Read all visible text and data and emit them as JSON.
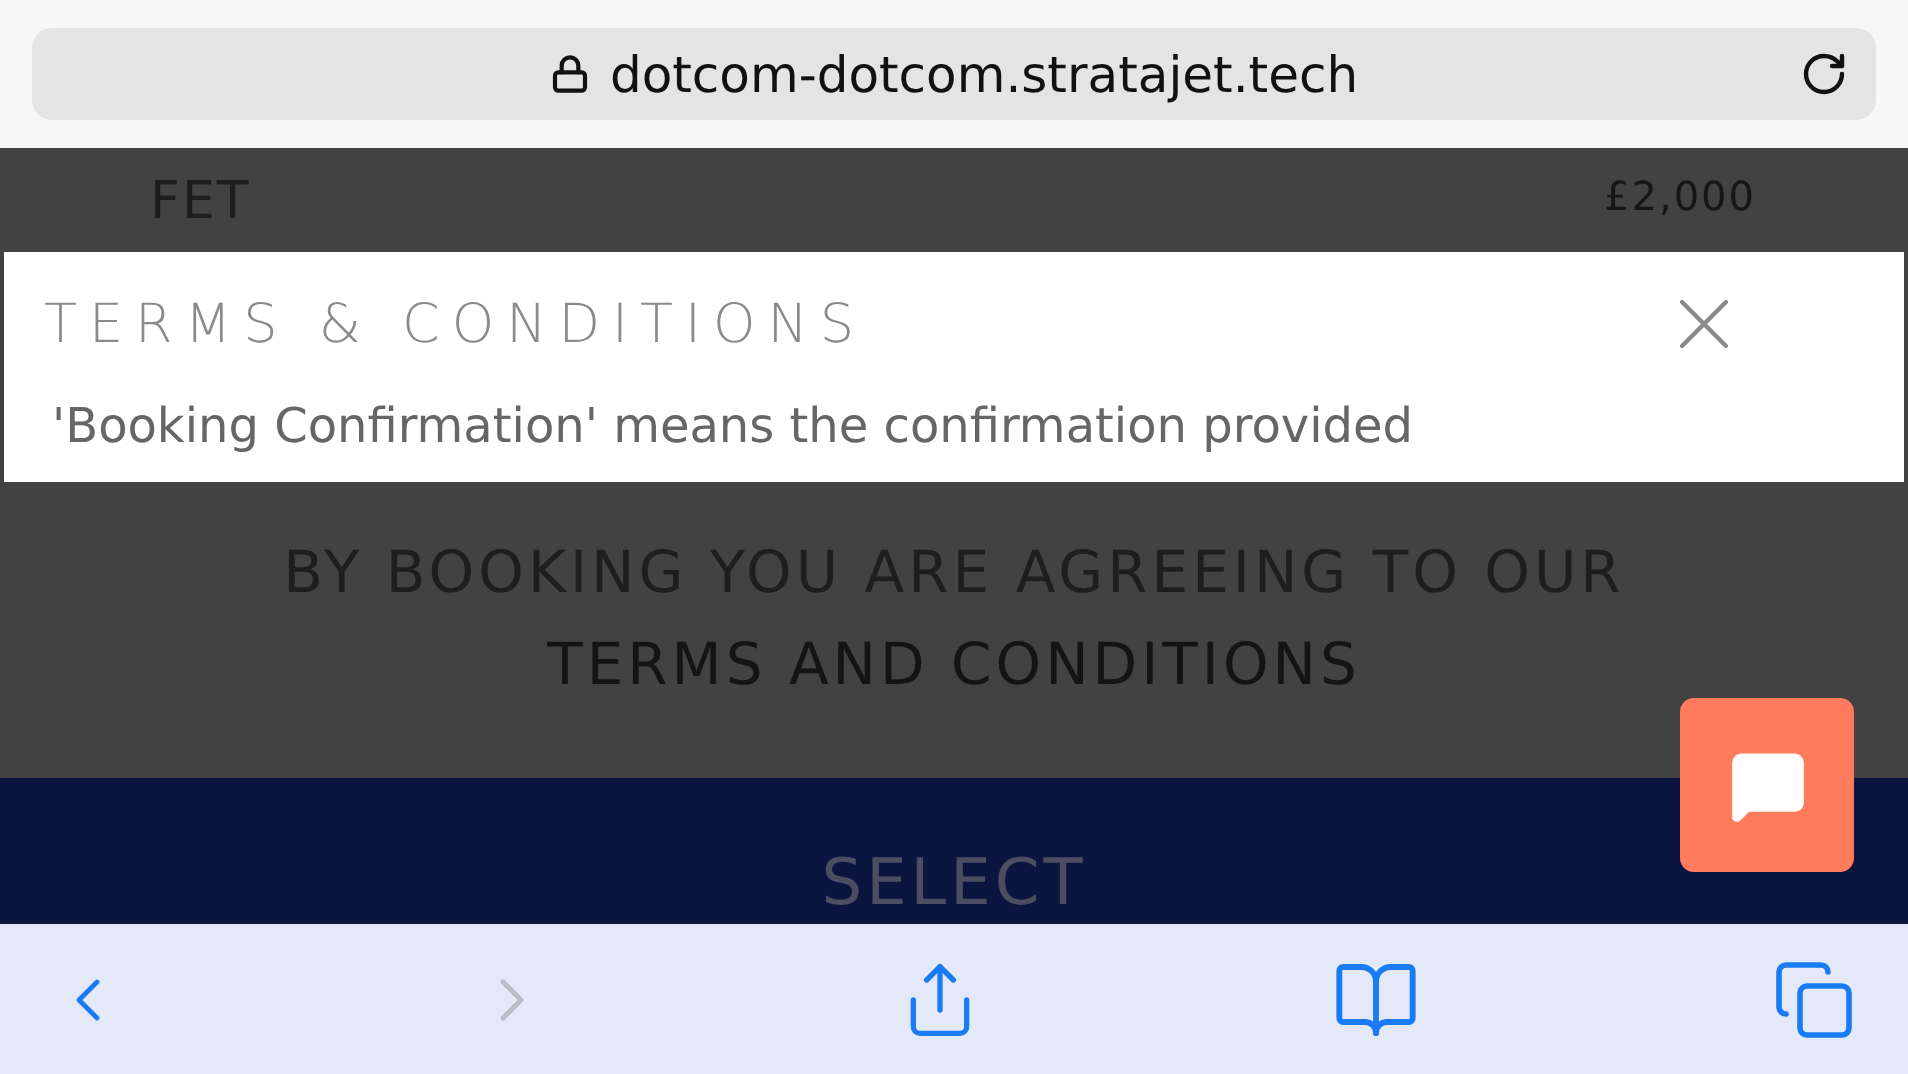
{
  "browser": {
    "url": "dotcom-dotcom.stratajet.tech"
  },
  "page": {
    "row": {
      "label": "FET",
      "price": "£2,000"
    },
    "notice": "BY BOOKING YOU ARE AGREEING TO OUR",
    "terms_link": "TERMS AND CONDITIONS",
    "select_button": "SELECT"
  },
  "modal": {
    "title": "TERMS & CONDITIONS",
    "body": "'Booking Confirmation' means the confirmation provided"
  },
  "toolbar": [
    {
      "kind": "back",
      "disabled": false
    },
    {
      "kind": "forward",
      "disabled": true
    },
    {
      "kind": "share",
      "disabled": false
    },
    {
      "kind": "bookmarks",
      "disabled": false
    },
    {
      "kind": "tabs",
      "disabled": false
    }
  ]
}
